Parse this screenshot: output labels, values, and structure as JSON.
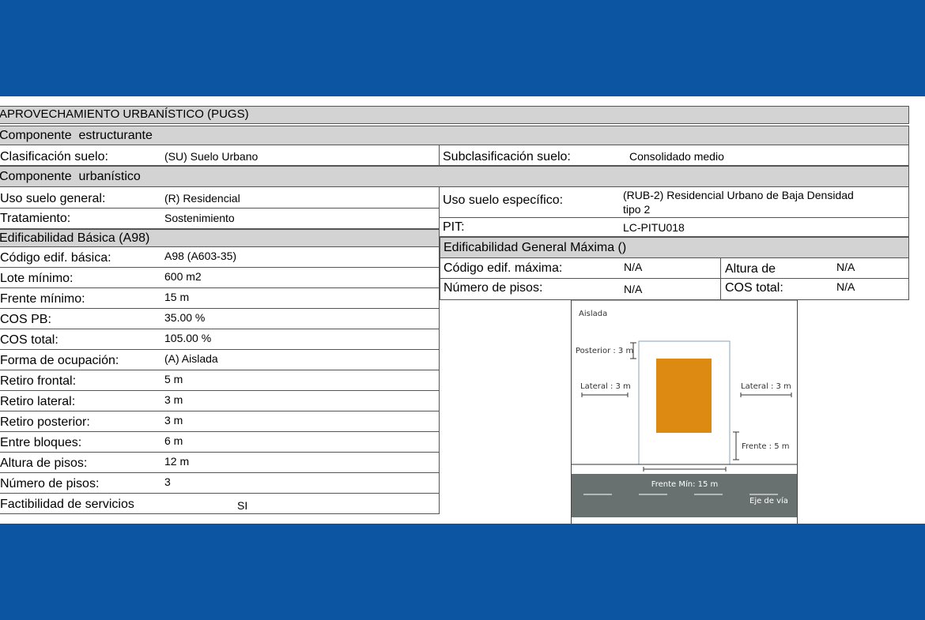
{
  "header": {
    "title": "APROVECHAMIENTO URBANÍSTICO (PUGS)"
  },
  "componente_estructurante": {
    "title": "Componente  estructurante",
    "clasificacion_label": "Clasificación suelo:",
    "clasificacion_value": "(SU) Suelo Urbano",
    "subclasificacion_label": "Subclasificación suelo:",
    "subclasificacion_value": "Consolidado medio"
  },
  "componente_urbanistico": {
    "title": "Componente  urbanístico",
    "uso_general_label": "Uso suelo general:",
    "uso_general_value": "(R) Residencial",
    "uso_especifico_label": "Uso suelo específico:",
    "uso_especifico_value_1": "(RUB-2) Residencial Urbano de Baja Densidad",
    "uso_especifico_value_2": "tipo 2",
    "tratamiento_label": "Tratamiento:",
    "tratamiento_value": "Sostenimiento",
    "pit_label": "PIT:",
    "pit_value": "LC-PITU018"
  },
  "edificabilidad_basica": {
    "title": "Edificabilidad Básica (A98)",
    "rows": [
      {
        "label": "Código edif. básica:",
        "value": "A98 (A603-35)"
      },
      {
        "label": "Lote mínimo:",
        "value": "600 m2"
      },
      {
        "label": "Frente mínimo:",
        "value": "15 m"
      },
      {
        "label": "COS PB:",
        "value": "35.00 %"
      },
      {
        "label": "COS total:",
        "value": "105.00 %"
      },
      {
        "label": "Forma de ocupación:",
        "value": "(A) Aislada"
      },
      {
        "label": "Retiro frontal:",
        "value": "5 m"
      },
      {
        "label": "Retiro lateral:",
        "value": "3 m"
      },
      {
        "label": "Retiro posterior:",
        "value": "3 m"
      },
      {
        "label": "Entre bloques:",
        "value": "6 m"
      },
      {
        "label": "Altura de pisos:",
        "value": "12 m"
      },
      {
        "label": "Número de pisos:",
        "value": "3"
      },
      {
        "label": "Factibilidad de servicios",
        "value": "SI"
      }
    ]
  },
  "edificabilidad_maxima": {
    "title": "Edificabilidad General Máxima ()",
    "codigo_label": "Código edif. máxima:",
    "codigo_value": "N/A",
    "altura_label": "Altura de",
    "altura_value": "N/A",
    "pisos_label": "Número de pisos:",
    "pisos_value": "N/A",
    "cos_label": "COS total:",
    "cos_value": "N/A"
  },
  "diagram": {
    "title": "Aislada",
    "posterior": "Posterior : 3 m",
    "lateral_left": "Lateral : 3 m",
    "lateral_right": "Lateral : 3 m",
    "frente": "Frente : 5 m",
    "frente_min": "Frente Mín: 15 m",
    "eje": "Eje de vía",
    "building_color": "#dd8a12",
    "road_color": "#68716f"
  }
}
